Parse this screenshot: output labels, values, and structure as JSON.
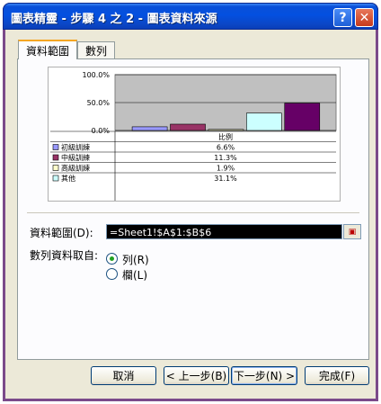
{
  "window": {
    "title": "圖表精靈 - 步驟 4 之 2 - 圖表資料來源"
  },
  "titlebar": {
    "help_glyph": "?",
    "close_glyph": "✕"
  },
  "tabs": [
    {
      "label": "資料範圍"
    },
    {
      "label": "數列"
    }
  ],
  "chart_data": {
    "type": "bar",
    "ytick_labels": [
      "100.0%",
      "50.0%",
      "0.0%"
    ],
    "ylim": [
      0,
      1
    ],
    "table_header": "比例",
    "grid": true,
    "series": [
      {
        "name": "初級訓練",
        "value": 0.066,
        "label": "6.6%",
        "color": "#9999ff"
      },
      {
        "name": "中級訓練",
        "value": 0.113,
        "label": "11.3%",
        "color": "#993366"
      },
      {
        "name": "高級訓練",
        "value": 0.019,
        "label": "1.9%",
        "color": "#ffffcc"
      },
      {
        "name": "其他",
        "value": 0.311,
        "label": "31.1%",
        "color": "#ccffff"
      },
      {
        "name": "",
        "value": 0.49,
        "label": "",
        "color": "#660066"
      }
    ]
  },
  "range": {
    "label": "資料範圍(D):",
    "value": "=Sheet1!$A$1:$B$6",
    "button_glyph": "▣"
  },
  "series_in": {
    "label": "數列資料取自:",
    "options": [
      {
        "label": "列(R)",
        "checked": true
      },
      {
        "label": "欄(L)",
        "checked": false
      }
    ]
  },
  "buttons": {
    "cancel": "取消",
    "back": "< 上一步(B)",
    "next": "下一步(N) >",
    "finish": "完成(F)"
  }
}
